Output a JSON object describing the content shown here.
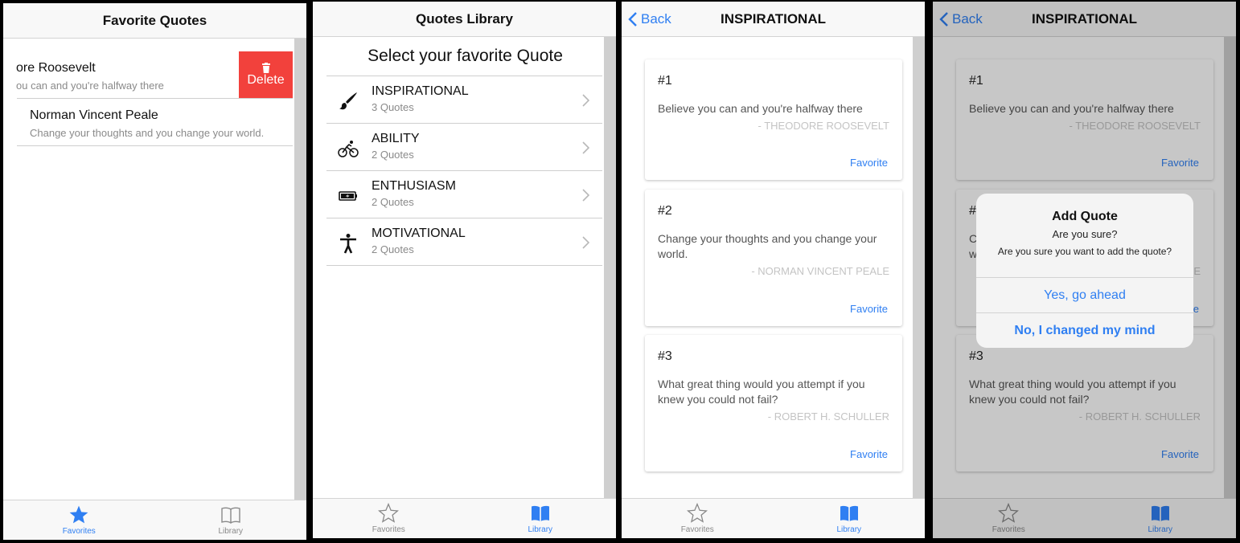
{
  "screen_favorites": {
    "title": "Favorite Quotes",
    "rows": [
      {
        "name": "ore Roosevelt",
        "quote": "ou can and you're halfway there"
      },
      {
        "name": "Norman Vincent Peale",
        "quote": "Change your thoughts and you change your world."
      }
    ],
    "delete_label": "Delete",
    "tabs": [
      {
        "label": "Favorites"
      },
      {
        "label": "Library"
      }
    ]
  },
  "screen_library": {
    "title": "Quotes Library",
    "heading": "Select your favorite Quote",
    "categories": [
      {
        "name": "INSPIRATIONAL",
        "count": "3 Quotes",
        "icon": "paintbrush-icon"
      },
      {
        "name": "ABILITY",
        "count": "2 Quotes",
        "icon": "bicycle-icon"
      },
      {
        "name": "ENTHUSIASM",
        "count": "2 Quotes",
        "icon": "battery-charging-icon"
      },
      {
        "name": "MOTIVATIONAL",
        "count": "2 Quotes",
        "icon": "accessibility-person-icon"
      }
    ],
    "tabs": [
      {
        "label": "Favorites"
      },
      {
        "label": "Library"
      }
    ]
  },
  "screen_category": {
    "back_label": "Back",
    "title": "INSPIRATIONAL",
    "quotes": [
      {
        "num": "#1",
        "text": "Believe you can and you're halfway there",
        "author": "- THEODORE ROOSEVELT",
        "action": "Favorite"
      },
      {
        "num": "#2",
        "text": "Change your thoughts and you change your world.",
        "author": "- NORMAN VINCENT PEALE",
        "action": "Favorite"
      },
      {
        "num": "#3",
        "text": "What great thing would you attempt if you knew you could not fail?",
        "author": "- ROBERT H. SCHULLER",
        "action": "Favorite"
      }
    ],
    "tabs": [
      {
        "label": "Favorites"
      },
      {
        "label": "Library"
      }
    ]
  },
  "alert": {
    "title": "Add Quote",
    "subtitle": "Are you sure?",
    "message": "Are you sure you want to add the quote?",
    "confirm": "Yes, go ahead",
    "cancel": "No, I changed my mind"
  },
  "colors": {
    "accent": "#2f7ff2",
    "delete": "#f2413c",
    "muted": "#8a8a8a"
  }
}
